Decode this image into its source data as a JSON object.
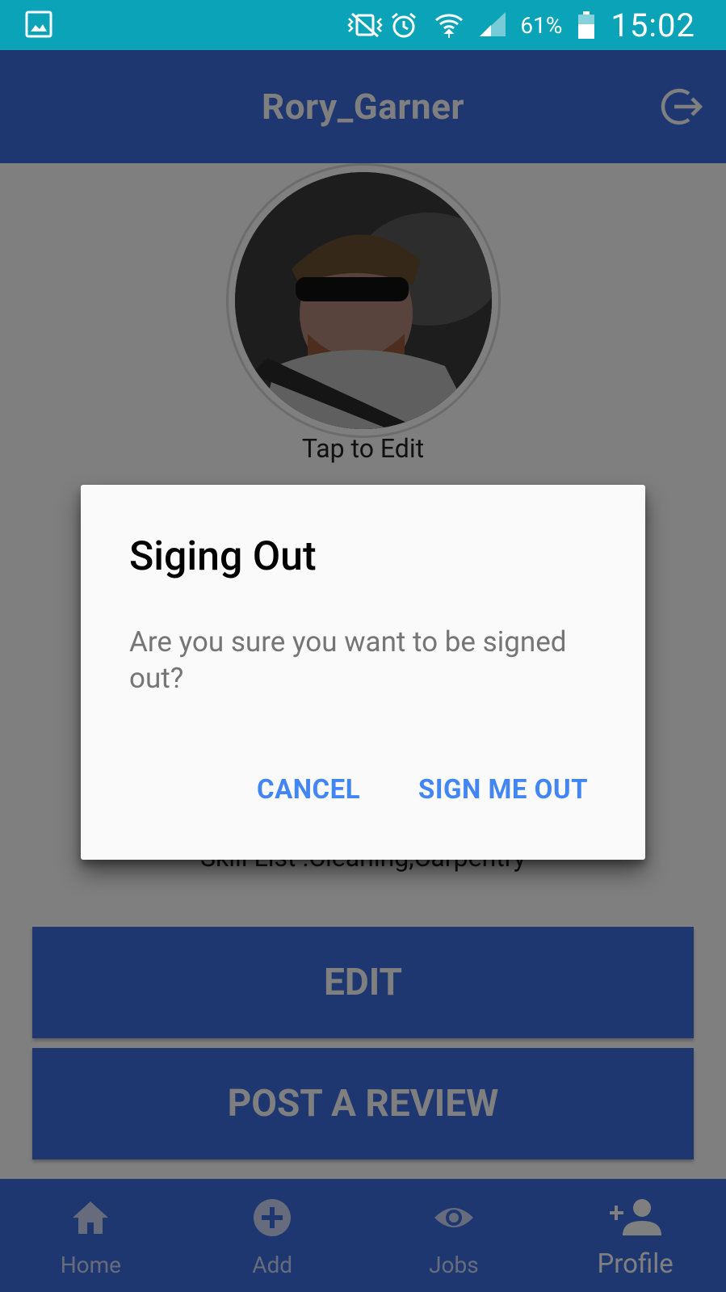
{
  "status_bar": {
    "battery_percent": "61%",
    "time": "15:02",
    "icons": [
      "gallery-icon",
      "vibrate-mute-icon",
      "alarm-icon",
      "wifi-icon",
      "signal-icon",
      "battery-icon"
    ]
  },
  "app_bar": {
    "title": "Rory_Garner",
    "logout_icon": "logout-icon"
  },
  "profile": {
    "tap_to_edit": "Tap to Edit",
    "skill_list": "Skill List :Cleaning,Carpentry",
    "edit_button": "EDIT",
    "review_button": "POST A REVIEW"
  },
  "bottom_nav": {
    "items": [
      {
        "label": "Home",
        "icon": "home-icon"
      },
      {
        "label": "Add",
        "icon": "add-circle-icon"
      },
      {
        "label": "Jobs",
        "icon": "eye-icon"
      },
      {
        "label": "Profile",
        "icon": "person-add-icon"
      }
    ],
    "active": "Profile"
  },
  "dialog": {
    "title": "Siging Out",
    "message": "Are you sure you want to be signed out?",
    "cancel_label": "CANCEL",
    "confirm_label": "SIGN ME OUT"
  },
  "colors": {
    "status_bar": "#0aa3b8",
    "primary": "#3f6fe0",
    "dialog_button": "#4285f4",
    "scrim": "rgba(0,0,0,0.5)"
  }
}
